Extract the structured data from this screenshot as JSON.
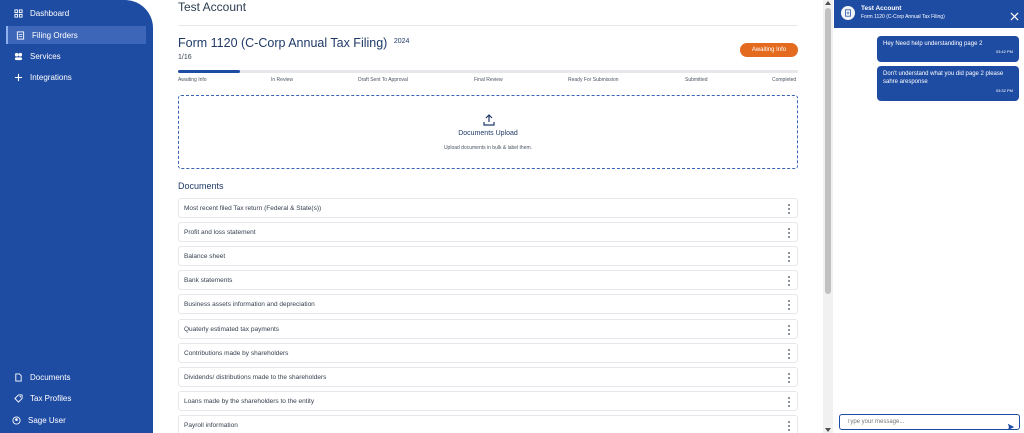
{
  "sidebar": {
    "top_items": [
      {
        "label": "Dashboard",
        "icon": "dashboard-icon"
      },
      {
        "label": "Filing Orders",
        "icon": "filing-orders-icon",
        "active": true
      },
      {
        "label": "Services",
        "icon": "services-icon"
      },
      {
        "label": "Integrations",
        "icon": "plus-icon"
      }
    ],
    "bottom_items": [
      {
        "label": "Documents",
        "icon": "document-icon"
      },
      {
        "label": "Tax Profiles",
        "icon": "tax-profiles-icon"
      },
      {
        "label": "Sage User",
        "icon": "user-icon"
      }
    ]
  },
  "main": {
    "page_title": "Test Account",
    "form_title": "Form 1120 (C-Corp Annual Tax Filing)",
    "form_year": "2024",
    "form_count": "1/16",
    "status_button": "Awaiting Info",
    "progress": 0.1,
    "steps": [
      "Awaiting Info",
      "In Review",
      "Draft Sent To Approval",
      "Final Review",
      "Ready For Submission",
      "Submitted",
      "Completed"
    ],
    "upload": {
      "title": "Documents Upload",
      "subtitle": "Upload documents in bulk & label them."
    },
    "documents_heading": "Documents",
    "documents": [
      "Most recent filed Tax return (Federal & State(s))",
      "Profit and loss statement",
      "Balance sheet",
      "Bank statements",
      "Business assets information and depreciation",
      "Quaterly estimated tax payments",
      "Contributions made by shareholders",
      "Dividends/ distributions made to the shareholders",
      "Loans made by the shareholders to the entity",
      "Payroll information"
    ]
  },
  "chat": {
    "name": "Test Account",
    "subtitle": "Form 1120 (C-Corp Annual Tax Filing)",
    "messages": [
      {
        "text": "Hey Need help understanding page 2",
        "time": "03:42 PM"
      },
      {
        "text": "Don't understand what you did page 2 please sahre aresponse",
        "time": "03:32 PM"
      }
    ],
    "input_placeholder": "Type your message..."
  },
  "colors": {
    "brand": "#1f4ca3",
    "status_orange": "#e36a1f"
  }
}
